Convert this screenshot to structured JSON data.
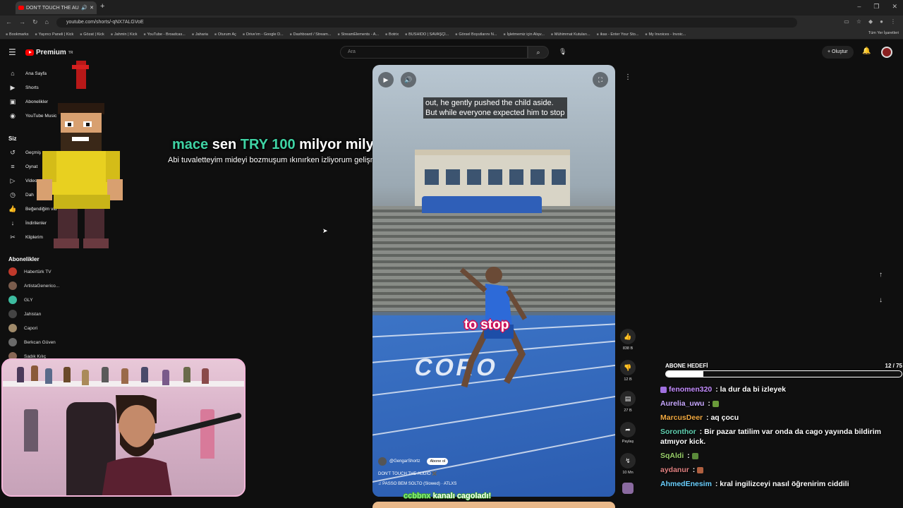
{
  "browser": {
    "tab_title": "DON'T TOUCH THE AUDIO",
    "url": "youtube.com/shorts/-qNX7ALGVoE",
    "bookmarks": [
      "Bookmarks",
      "Yayıncı Paneli | Kick",
      "Gözat | Kick",
      "Jahmin | Kick",
      "YouTube - Broadcas...",
      "Jaharia",
      "Oturum Aç",
      "Drive'ım - Google D...",
      "Dashboard / Stream...",
      "StreamElements - A...",
      "Botrix",
      "BUSHIDO | SAVAŞÇI...",
      "Görsel Boyutlarını N...",
      "İşletmemiz için Alışv...",
      "Mühimmat Kutuları...",
      "ikas - Enter Your Sto...",
      "My Invoices - Invoic..."
    ],
    "all_bookmarks": "Tüm Yer İşaretleri"
  },
  "header": {
    "logo": "Premium",
    "logo_sup": "TR",
    "search_placeholder": "Ara",
    "create_label": "Oluştur"
  },
  "sidebar": {
    "items": [
      {
        "icon": "⌂",
        "label": "Ana Sayfa"
      },
      {
        "icon": "▶",
        "label": "Shorts"
      },
      {
        "icon": "▣",
        "label": "Abonelikler"
      },
      {
        "icon": "◉",
        "label": "YouTube Music"
      }
    ],
    "you_header": "Siz",
    "you_items": [
      {
        "icon": "↺",
        "label": "Geçmiş"
      },
      {
        "icon": "≡",
        "label": "Oynat"
      },
      {
        "icon": "▷",
        "label": "Video"
      },
      {
        "icon": "◷",
        "label": "Dah"
      },
      {
        "icon": "👍",
        "label": "Beğendiğim vid"
      },
      {
        "icon": "↓",
        "label": "İndirilenler"
      },
      {
        "icon": "✂",
        "label": "Kliplerim"
      }
    ],
    "subs_header": "Abonelikler",
    "subs": [
      {
        "name": "Habertürk TV",
        "color": "#c0392b"
      },
      {
        "name": "ArtistaGenerico...",
        "color": "#7a5c4c"
      },
      {
        "name": "GLY",
        "color": "#3dbca0"
      },
      {
        "name": "Jahistan",
        "color": "#444444"
      },
      {
        "name": "Capori",
        "color": "#a08a6a"
      },
      {
        "name": "Berkcan Güven",
        "color": "#6a6a6a"
      },
      {
        "name": "Sadık Kılıç",
        "color": "#886655"
      }
    ]
  },
  "alert": {
    "name": "mace",
    "sen1": "sen",
    "amount": "TRY 100",
    "rest": "milyor milyar sen neağptın!",
    "message": "Abi tuvaletteyim mideyi bozmuşum ıkınırken izliyorum gelişmelerden haberdar ederim"
  },
  "video": {
    "caption_line1": "out, he gently pushed the child aside.",
    "caption_line2": "But while everyone expected him to stop",
    "burned_sub": "to stop",
    "track_text": "CORO",
    "channel": "@GengarShortz",
    "subscribe": "Abone ol",
    "title": "DON'T TOUCH THE AUDIO ✖️",
    "music": "♫ PASSO BEM SOLTO (Slowed) · ATLXS"
  },
  "actions": {
    "like": "838 B",
    "dislike": "12 B",
    "comments": "27 B",
    "share": "Paylaş",
    "remix": "10 Mn"
  },
  "overlay_bottom": {
    "name": "ccbbnx",
    "text": "kanalı cagoladı!"
  },
  "goal": {
    "label": "ABONE HEDEFİ",
    "count": "12 / 75",
    "progress": 0.16
  },
  "chat": [
    {
      "user": "fenomen320",
      "color": "#c48cff",
      "text": "la dur da bi izleyek",
      "badge": true
    },
    {
      "user": "Aurelia_uwu",
      "color": "#c8a8ff",
      "text": "",
      "emote": "#6a9a3a"
    },
    {
      "user": "MarcusDeer",
      "color": "#f0a840",
      "text": "aq çocu"
    },
    {
      "user": "Soronthor",
      "color": "#5fd0b0",
      "text": "Bir pazar tatilim var onda da cago yayında bildirim atmıyor kick."
    },
    {
      "user": "SqAldi",
      "color": "#9ad06a",
      "text": "",
      "emote": "#5a8a3a"
    },
    {
      "user": "aydanur",
      "color": "#e08080",
      "text": "",
      "emote": "#b06040"
    },
    {
      "user": "AhmedEnesim",
      "color": "#6ad0ff",
      "text": "kral ingilizceyi nasıl öğrenirim ciddili"
    }
  ]
}
